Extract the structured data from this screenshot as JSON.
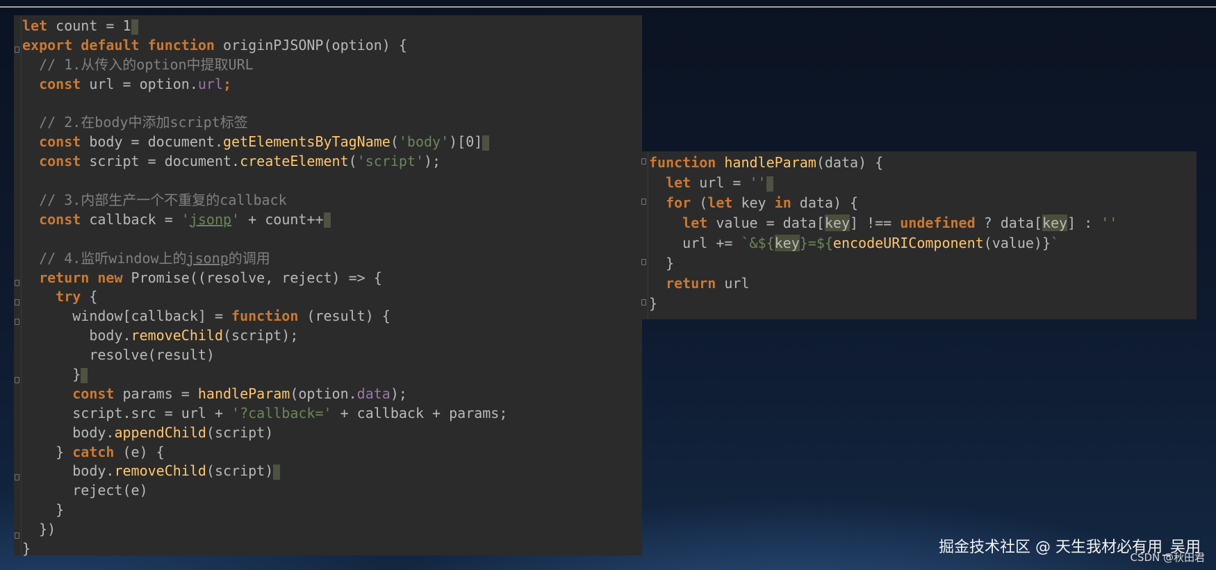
{
  "left_code": {
    "l1": {
      "a": "let",
      "b": " count = ",
      "c": "1"
    },
    "l2": {
      "a": "export default function ",
      "b": "originPJSONP",
      "c": "(option) {"
    },
    "l3": "  // 1.从传入的option中提取URL",
    "l4": {
      "a": "  const",
      "b": " url = option.",
      "c": "url",
      "d": ";"
    },
    "l6": "  // 2.在body中添加script标签",
    "l7": {
      "a": "  const",
      "b": " body = document.",
      "c": "getElementsByTagName",
      "d": "(",
      "e": "'body'",
      "f": ")[0]"
    },
    "l8": {
      "a": "  const",
      "b": " script = document.",
      "c": "createElement",
      "d": "(",
      "e": "'script'",
      "f": ");"
    },
    "l10": "  // 3.内部生产一个不重复的callback",
    "l11": {
      "a": "  const",
      "b": " callback = ",
      "c": "'",
      "d": "jsonp",
      "e": "'",
      "f": " + count++"
    },
    "l13": {
      "a": "  // 4.监听window上的",
      "b": "jsonp",
      "c": "的调用"
    },
    "l14": {
      "a": "  return new",
      "b": " Promise((resolve, reject) => {"
    },
    "l15": {
      "a": "    try",
      "b": " {"
    },
    "l16": {
      "a": "      window[callback] = ",
      "b": "function",
      "c": " (result) {"
    },
    "l17": {
      "a": "        body.",
      "b": "removeChild",
      "c": "(script);"
    },
    "l18": "        resolve(result)",
    "l19": "      }",
    "l20": {
      "a": "      const",
      "b": " params = ",
      "c": "handleParam",
      "d": "(option.",
      "e": "data",
      "f": ");"
    },
    "l21": {
      "a": "      script.src = url + ",
      "b": "'?callback='",
      "c": " + callback + params;"
    },
    "l22": {
      "a": "      body.",
      "b": "appendChild",
      "c": "(script)"
    },
    "l23": {
      "a": "    } ",
      "b": "catch",
      "c": " (e) {"
    },
    "l24": {
      "a": "      body.",
      "b": "removeChild",
      "c": "(script)"
    },
    "l25": "      reject(e)",
    "l26": "    }",
    "l27": "  })",
    "l28": "}"
  },
  "right_code": {
    "r1": {
      "a": "function",
      "b": " ",
      "c": "handleParam",
      "d": "(data) {"
    },
    "r2": {
      "a": "  let",
      "b": " url = ",
      "c": "''"
    },
    "r3": {
      "a": "  for",
      "b": " (",
      "c": "let",
      "d": " key ",
      "e": "in",
      "f": " data) {"
    },
    "r4": {
      "a": "    let",
      "b": " value = data[",
      "c": "key",
      "d": "] !== ",
      "e": "undefined",
      "f": " ? data[",
      "g": "key",
      "h": "] : ",
      "i": "''"
    },
    "r5": {
      "a": "    url += ",
      "b": "`&${",
      "c": "key",
      "d": "}=${",
      "e": "encodeURIComponent",
      "f": "(value)}",
      "g": "`"
    },
    "r6": "  }",
    "r7": {
      "a": "  return",
      "b": " url"
    },
    "r8": "}"
  },
  "watermark": {
    "main": "掘金技术社区 @ 天生我材必有用_吴用",
    "csdn": "CSDN @秋田君"
  }
}
